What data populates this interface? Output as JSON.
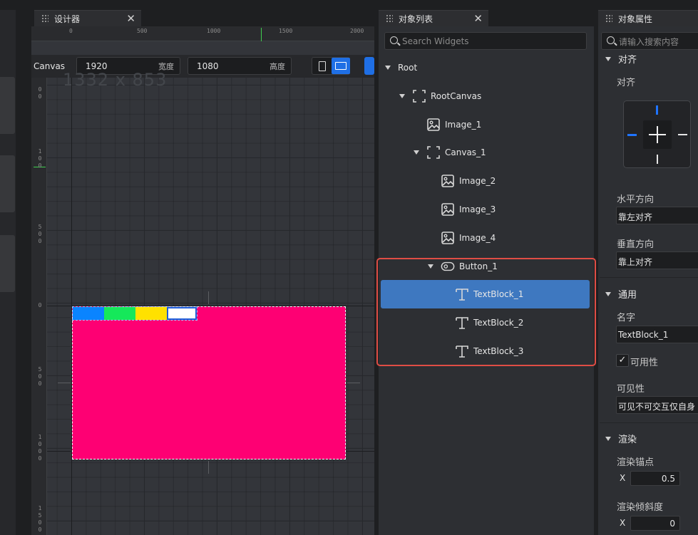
{
  "tabs": {
    "designer": "设计器",
    "object_list": "对象列表",
    "object_props": "对象属性",
    "close_glyph": "✕"
  },
  "designer": {
    "ruler_ticks": [
      "0",
      "500",
      "1000",
      "1500",
      "2000"
    ],
    "ruler_left_labels": [
      "0\n0",
      "1\n0\n0",
      "5\n0\n0",
      "0",
      "5\n0\n0",
      "1\n0\n0\n0",
      "1\n5\n0\n0"
    ],
    "canvas_label": "Canvas",
    "width_value": "1920",
    "width_suffix": "宽度",
    "height_value": "1080",
    "height_suffix": "高度",
    "faded_text": "1332 x 853",
    "button_colors": [
      "#0a84ff",
      "#15e85a",
      "#ffe100"
    ],
    "canvas_color": "#fe0073"
  },
  "objlist": {
    "search_placeholder": "Search Widgets",
    "items": [
      {
        "label": "Root",
        "indent": 0,
        "icon": "none",
        "caret": true
      },
      {
        "label": "RootCanvas",
        "indent": 1,
        "icon": "canvas-icon",
        "caret": true
      },
      {
        "label": "Image_1",
        "indent": 2,
        "icon": "image-icon",
        "caret": false
      },
      {
        "label": "Canvas_1",
        "indent": 2,
        "icon": "canvas-icon",
        "caret": true
      },
      {
        "label": "Image_2",
        "indent": 3,
        "icon": "image-icon",
        "caret": false
      },
      {
        "label": "Image_3",
        "indent": 3,
        "icon": "image-icon",
        "caret": false
      },
      {
        "label": "Image_4",
        "indent": 3,
        "icon": "image-icon",
        "caret": false
      },
      {
        "label": "Button_1",
        "indent": 3,
        "icon": "button-icon",
        "caret": true
      },
      {
        "label": "TextBlock_1",
        "indent": 4,
        "icon": "text-icon",
        "caret": false,
        "selected": true
      },
      {
        "label": "TextBlock_2",
        "indent": 4,
        "icon": "text-icon",
        "caret": false
      },
      {
        "label": "TextBlock_3",
        "indent": 4,
        "icon": "text-icon",
        "caret": false
      }
    ]
  },
  "props": {
    "search_placeholder": "请输入搜索内容",
    "section_align": "对齐",
    "label_align": "对齐",
    "label_horizontal": "水平方向",
    "value_horizontal": "靠左对齐",
    "label_vertical": "垂直方向",
    "value_vertical": "靠上对齐",
    "section_general": "通用",
    "label_name": "名字",
    "value_name": "TextBlock_1",
    "label_enabled": "可用性",
    "enabled_check": "✓",
    "label_visibility": "可见性",
    "value_visibility": "可见不可交互仅自身",
    "section_render": "渲染",
    "label_pivot": "渲染锚点",
    "pivot_axis": "X",
    "pivot_x": "0.5",
    "label_shear": "渲染倾斜度",
    "shear_axis": "X",
    "shear_x": "0"
  }
}
